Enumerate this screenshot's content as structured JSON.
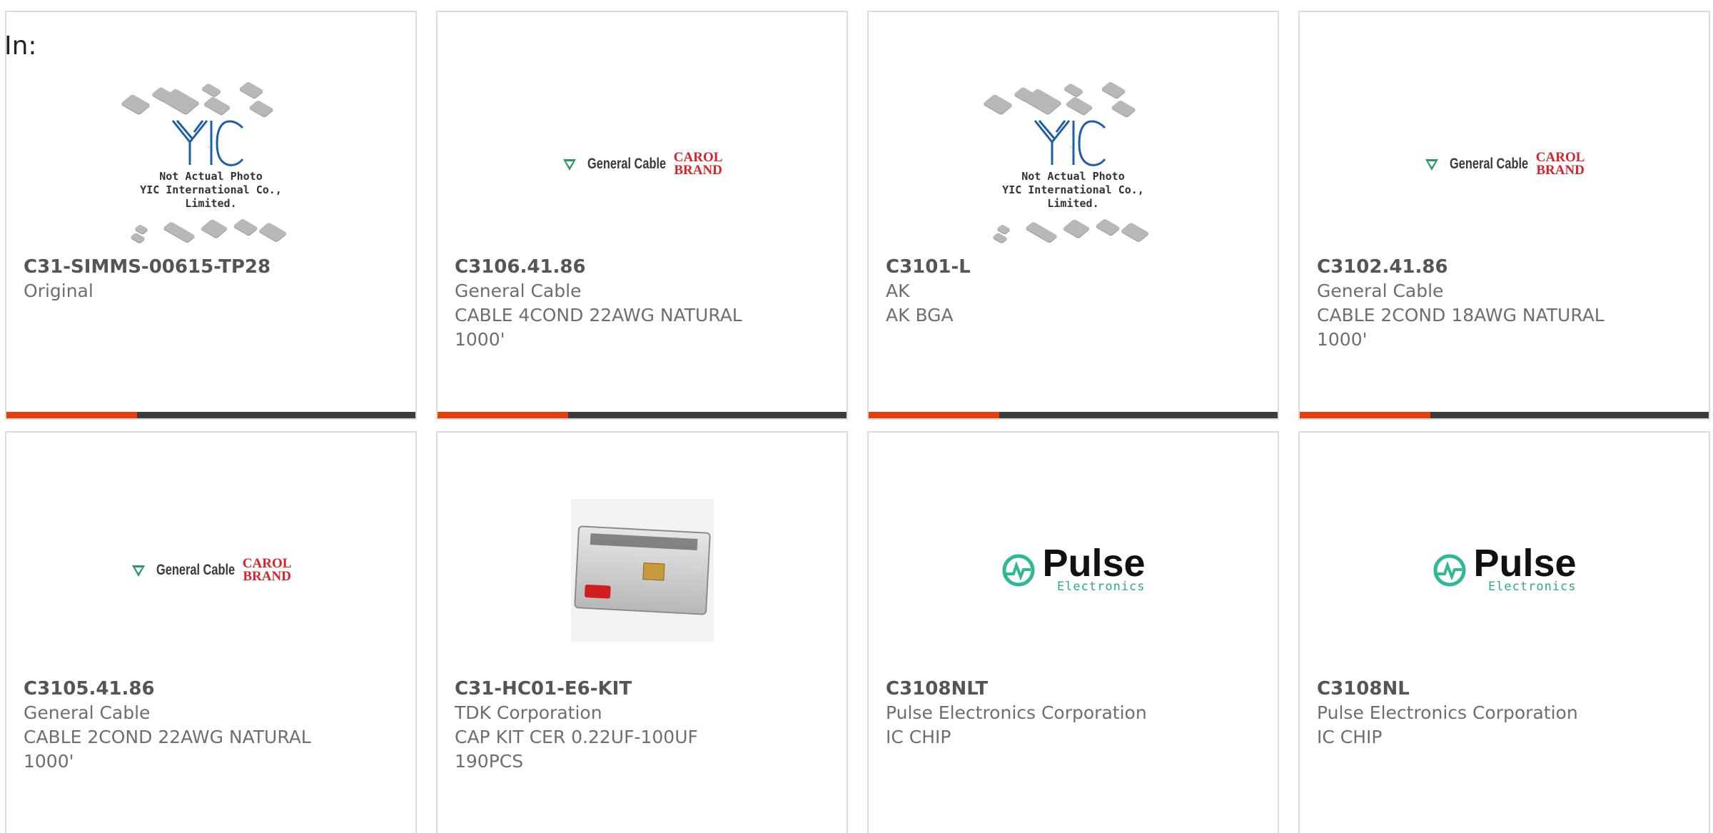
{
  "header": {
    "in_label": "In:"
  },
  "cards": [
    {
      "part_number": "C31-SIMMS-00615-TP28",
      "lines": [
        "Original"
      ],
      "image": {
        "type": "placeholder",
        "logo_text": "YIC",
        "caption_line1": "Not Actual Photo",
        "caption_line2": "YIC International Co., Limited."
      }
    },
    {
      "part_number": "C3106.41.86",
      "lines": [
        "General Cable",
        "CABLE 4COND 22AWG NATURAL",
        "1000'"
      ],
      "image": {
        "type": "brand-logo",
        "brand": "General Cable",
        "sub_brand_1": "CAROL",
        "sub_brand_2": "BRAND"
      }
    },
    {
      "part_number": "C3101-L",
      "lines": [
        "AK",
        "AK BGA"
      ],
      "image": {
        "type": "placeholder",
        "logo_text": "YIC",
        "caption_line1": "Not Actual Photo",
        "caption_line2": "YIC International Co., Limited."
      }
    },
    {
      "part_number": "C3102.41.86",
      "lines": [
        "General Cable",
        "CABLE 2COND 18AWG NATURAL",
        "1000'"
      ],
      "image": {
        "type": "brand-logo",
        "brand": "General Cable",
        "sub_brand_1": "CAROL",
        "sub_brand_2": "BRAND"
      }
    },
    {
      "part_number": "C3105.41.86",
      "lines": [
        "General Cable",
        "CABLE 2COND 22AWG NATURAL",
        "1000'"
      ],
      "image": {
        "type": "brand-logo",
        "brand": "General Cable",
        "sub_brand_1": "CAROL",
        "sub_brand_2": "BRAND"
      }
    },
    {
      "part_number": "C31-HC01-E6-KIT",
      "lines": [
        "TDK Corporation",
        "CAP KIT CER 0.22UF-100UF",
        "190PCS"
      ],
      "image": {
        "type": "product-photo"
      }
    },
    {
      "part_number": "C3108NLT",
      "lines": [
        "Pulse Electronics Corporation",
        "IC CHIP"
      ],
      "image": {
        "type": "brand-logo",
        "brand": "Pulse",
        "sub_brand_1": "Electronics"
      }
    },
    {
      "part_number": "C3108NL",
      "lines": [
        "Pulse Electronics Corporation",
        "IC CHIP"
      ],
      "image": {
        "type": "brand-logo",
        "brand": "Pulse",
        "sub_brand_1": "Electronics"
      }
    }
  ],
  "colors": {
    "accent_bar": "#e5400c",
    "dark_bar": "#3c3c3c",
    "card_border": "#dcdcdc",
    "text_muted": "#6e6e6e"
  }
}
